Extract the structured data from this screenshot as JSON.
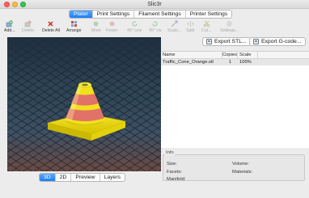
{
  "window": {
    "title": "Slic3r"
  },
  "tabs": [
    {
      "label": "Plater",
      "active": true
    },
    {
      "label": "Print Settings",
      "active": false
    },
    {
      "label": "Filament Settings",
      "active": false
    },
    {
      "label": "Printer Settings",
      "active": false
    }
  ],
  "toolbar": {
    "add": "Add...",
    "delete": "Delete",
    "delete_all": "Delete All",
    "arrange": "Arrange",
    "more": "More",
    "fewer": "Fewer",
    "rotate_ccw": "45° ccw",
    "rotate_cw": "45° cw",
    "scale": "Scale...",
    "split": "Split",
    "cut": "Cut...",
    "settings": "Settings..."
  },
  "export": {
    "stl": "Export STL...",
    "gcode": "Export G-code..."
  },
  "objects": {
    "headers": {
      "name": "Name",
      "copies": "Copies",
      "scale": "Scale"
    },
    "rows": [
      {
        "name": "Traffic_Cone_Orange.stl",
        "copies": "1",
        "scale": "100%"
      }
    ]
  },
  "view_tabs": [
    {
      "label": "3D",
      "active": true
    },
    {
      "label": "2D",
      "active": false
    },
    {
      "label": "Preview",
      "active": false
    },
    {
      "label": "Layers",
      "active": false
    }
  ],
  "info": {
    "title": "Info",
    "size": "Size:",
    "facets": "Facets:",
    "manifold": "Manifold:",
    "volume": "Volume:",
    "materials": "Materials:"
  },
  "colors": {
    "accent": "#1b7ef6",
    "cone_yellow": "#f2e21b",
    "cone_stripe": "#e5746c"
  }
}
